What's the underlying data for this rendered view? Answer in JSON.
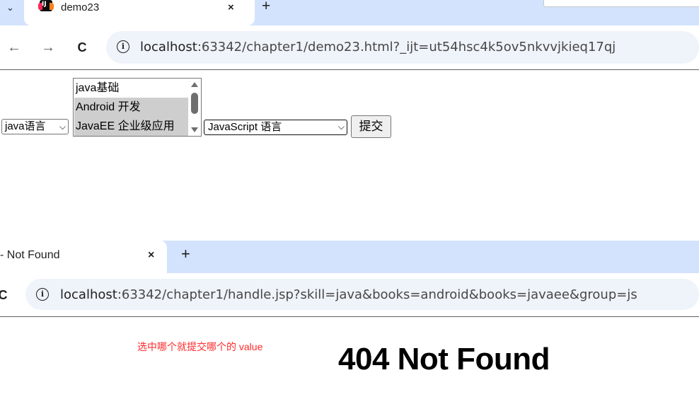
{
  "window1": {
    "tab": {
      "title": "demo23",
      "close": "×",
      "new_tab": "+",
      "menu": "⌄"
    },
    "toolbar": {
      "back": "←",
      "forward": "→",
      "reload": "C",
      "url_host": "localhost",
      "url_rest": ":63342/chapter1/demo23.html?_ijt=ut54hsc4k5ov5nkvvjkieq17qj"
    },
    "form": {
      "skill_select_value": "java语言",
      "books_options": [
        {
          "label": "java基础",
          "selected": false
        },
        {
          "label": "Android 开发",
          "selected": true
        },
        {
          "label": "JavaEE 企业级应用",
          "selected": true
        }
      ],
      "group_select_value": "JavaScript 语言",
      "submit_label": "提交"
    }
  },
  "window2": {
    "tab": {
      "title": "- Not Found",
      "close": "×",
      "new_tab": "+"
    },
    "toolbar": {
      "reload": "C",
      "url_host": "localhost",
      "url_rest": ":63342/chapter1/handle.jsp?skill=java&books=android&books=javaee&group=js"
    },
    "annotation": "选中哪个就提交哪个的 value",
    "heading": "404 Not Found"
  },
  "colors": {
    "tabstrip": "#d3e3fd",
    "omnibox": "#eff3fa",
    "annotation": "#ff2a2a",
    "selected_option": "#cecece"
  }
}
